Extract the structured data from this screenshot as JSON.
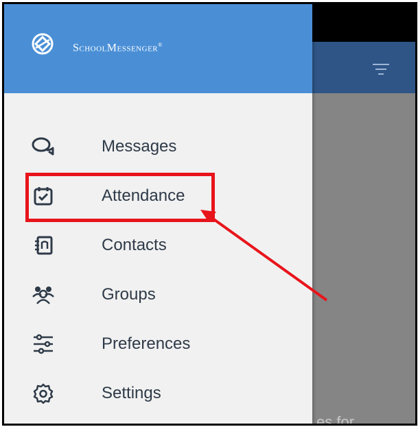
{
  "header": {
    "brand": "SchoolMessenger",
    "registered_mark": "®"
  },
  "nav": {
    "items": [
      {
        "label": "Messages",
        "icon": "chat-bubbles-icon"
      },
      {
        "label": "Attendance",
        "icon": "calendar-check-icon"
      },
      {
        "label": "Contacts",
        "icon": "contact-book-icon"
      },
      {
        "label": "Groups",
        "icon": "group-people-icon"
      },
      {
        "label": "Preferences",
        "icon": "sliders-icon"
      },
      {
        "label": "Settings",
        "icon": "gear-icon"
      }
    ]
  },
  "background": {
    "peek_text": "es for"
  },
  "annotation": {
    "color": "#e8141b",
    "target": "Attendance"
  },
  "colors": {
    "header_blue": "#4a8fd6",
    "dark_navy": "#2f5587",
    "drawer_bg": "#f1f1f1",
    "overlay_gray": "#858585",
    "icon_color": "#2e3a48"
  }
}
